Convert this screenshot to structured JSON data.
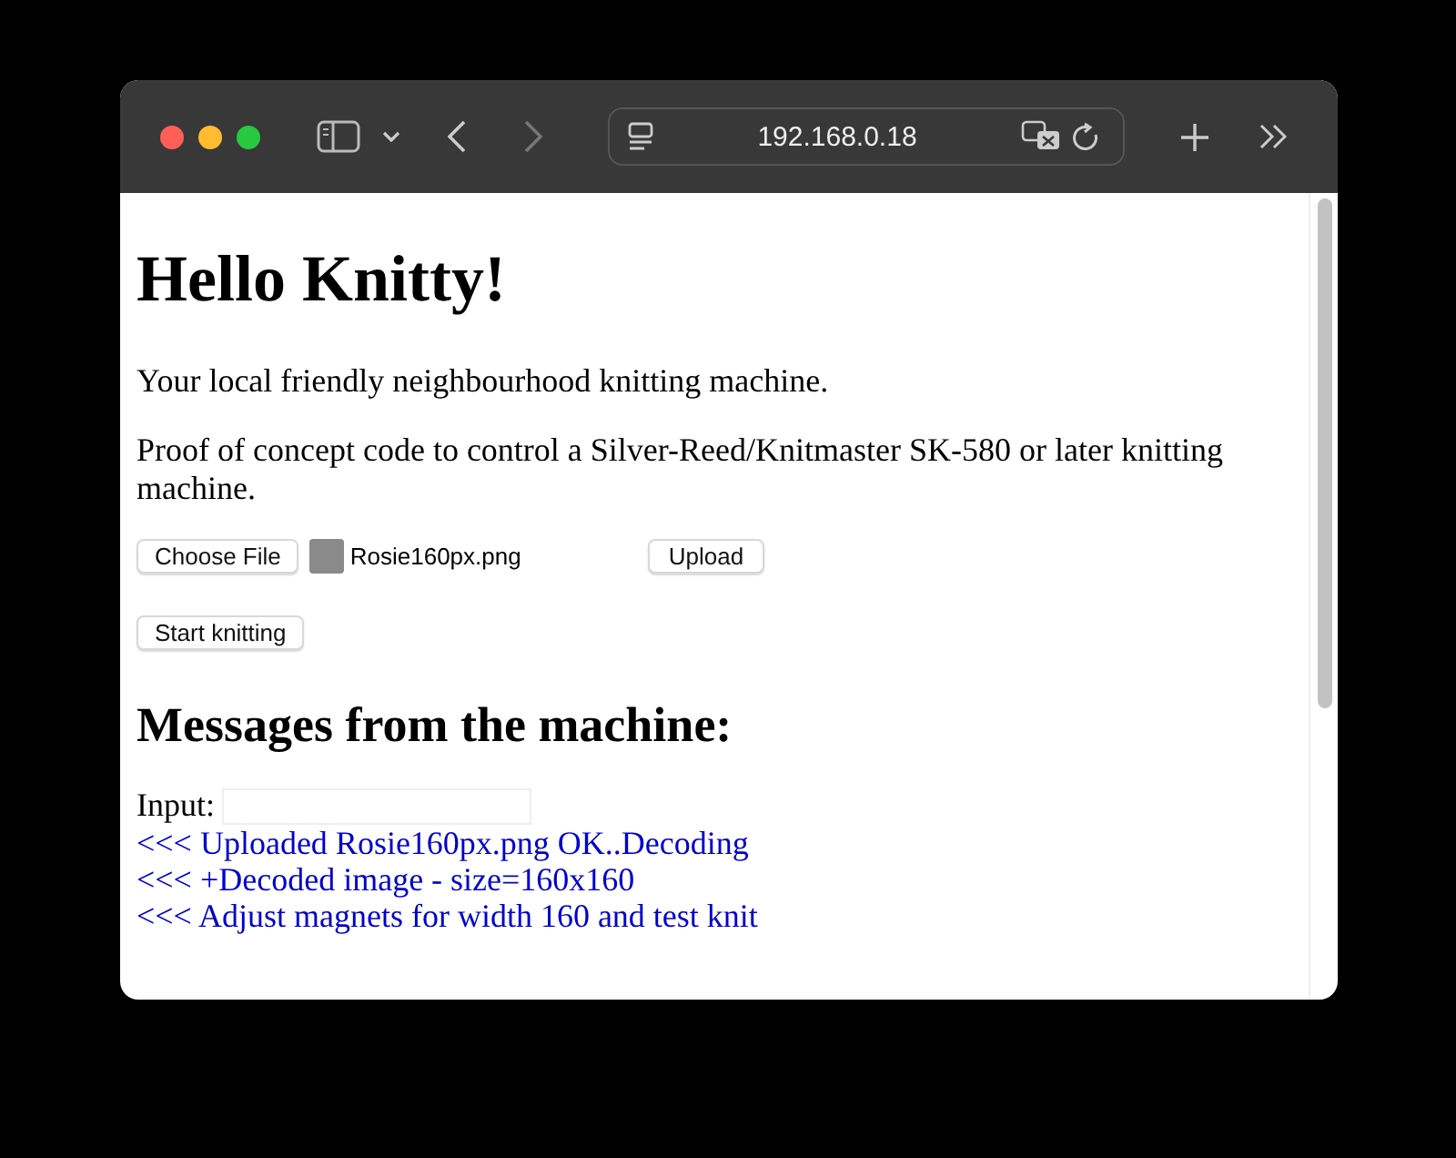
{
  "browser": {
    "address": "192.168.0.18"
  },
  "page": {
    "title": "Hello Knitty!",
    "intro": "Your local friendly neighbourhood knitting machine.",
    "description": "Proof of concept code to control a Silver-Reed/Knitmaster SK-580 or later knitting machine.",
    "file_button": "Choose File",
    "file_name": "Rosie160px.png",
    "upload_button": "Upload",
    "start_button": "Start knitting",
    "messages_heading": "Messages from the machine:",
    "input_label": "Input:",
    "messages": [
      "<<< Uploaded Rosie160px.png OK..Decoding",
      "<<< +Decoded image - size=160x160",
      "<<< Adjust magnets for width 160 and test knit"
    ]
  }
}
